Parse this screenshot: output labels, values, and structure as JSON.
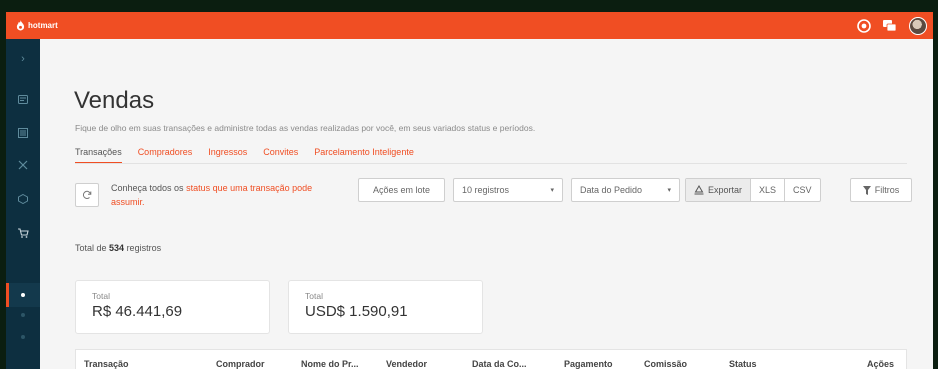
{
  "brand": {
    "name": "hotmart"
  },
  "page": {
    "title": "Vendas",
    "subtitle": "Fique de olho em suas transações e administre todas as vendas realizadas por você, em seus variados status e períodos."
  },
  "tabs": [
    {
      "label": "Transações",
      "active": true
    },
    {
      "label": "Compradores"
    },
    {
      "label": "Ingressos"
    },
    {
      "label": "Convites"
    },
    {
      "label": "Parcelamento Inteligente"
    }
  ],
  "info": {
    "prefix": "Conheça todos os ",
    "link": "status que uma transação pode assumir."
  },
  "toolbar": {
    "batch_actions": "Ações em lote",
    "records_select": "10 registros",
    "date_select": "Data do Pedido",
    "export": "Exportar",
    "xls": "XLS",
    "csv": "CSV",
    "filters": "Filtros"
  },
  "records": {
    "prefix": "Total de ",
    "count": "534",
    "suffix": " registros"
  },
  "totals": [
    {
      "label": "Total",
      "value": "R$ 46.441,69"
    },
    {
      "label": "Total",
      "value": "USD$ 1.590,91"
    }
  ],
  "table": {
    "columns": [
      "Transação",
      "Comprador",
      "Nome do Pr...",
      "Vendedor",
      "Data da Co...",
      "Pagamento",
      "Comissão",
      "Status",
      "Ações"
    ]
  },
  "colors": {
    "brand": "#f04e23",
    "sidebar": "#0d2f40"
  }
}
